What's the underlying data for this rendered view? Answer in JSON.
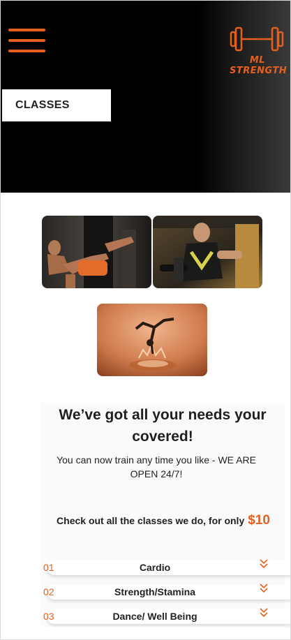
{
  "header": {
    "brand": "ML STRENGTH",
    "menu_icon": "hamburger-menu-icon",
    "logo_icon": "dumbbell-icon",
    "accent_color": "#e5601c"
  },
  "page_label": "CLASSES",
  "gallery": [
    {
      "alt": "kickboxing-photo"
    },
    {
      "alt": "weightlifting-photo"
    },
    {
      "alt": "dance-balance-photo"
    }
  ],
  "intro": {
    "headline": "We’ve got all your needs your covered!",
    "subline": "You can now train any time you like - WE ARE OPEN 24/7!",
    "pricing_text": "Check out all the classes we do, for only",
    "price": "$10"
  },
  "classes": [
    {
      "number": "01",
      "title": "Cardio"
    },
    {
      "number": "02",
      "title": "Strength/Stamina"
    },
    {
      "number": "03",
      "title": "Dance/ Well Being"
    }
  ]
}
